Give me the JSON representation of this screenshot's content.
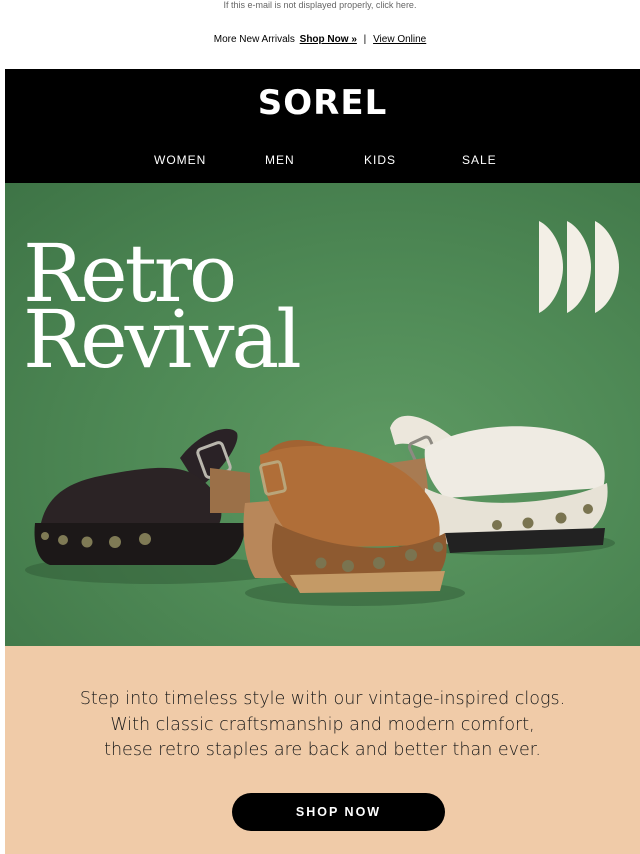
{
  "preheader": {
    "text": "If this e-mail is not displayed properly, click here."
  },
  "promo": {
    "text": "More New Arrivals",
    "shop_now": "Shop Now »",
    "separator": "|",
    "view_online": "View Online"
  },
  "header": {
    "logo": "SOREL",
    "nav": [
      {
        "label": "WOMEN"
      },
      {
        "label": "MEN"
      },
      {
        "label": "KIDS"
      },
      {
        "label": "SALE"
      }
    ]
  },
  "hero": {
    "title_line1": "Retro",
    "title_line2": "Revival",
    "colors": {
      "background": "#4f8a56"
    }
  },
  "content": {
    "lines": [
      "Step into timeless style with our vintage-inspired clogs.",
      "With classic craftsmanship and modern comfort,",
      "these retro staples are back and better than ever."
    ],
    "cta": "SHOP NOW",
    "colors": {
      "panel": "#f0cba8",
      "button": "#000000"
    }
  }
}
